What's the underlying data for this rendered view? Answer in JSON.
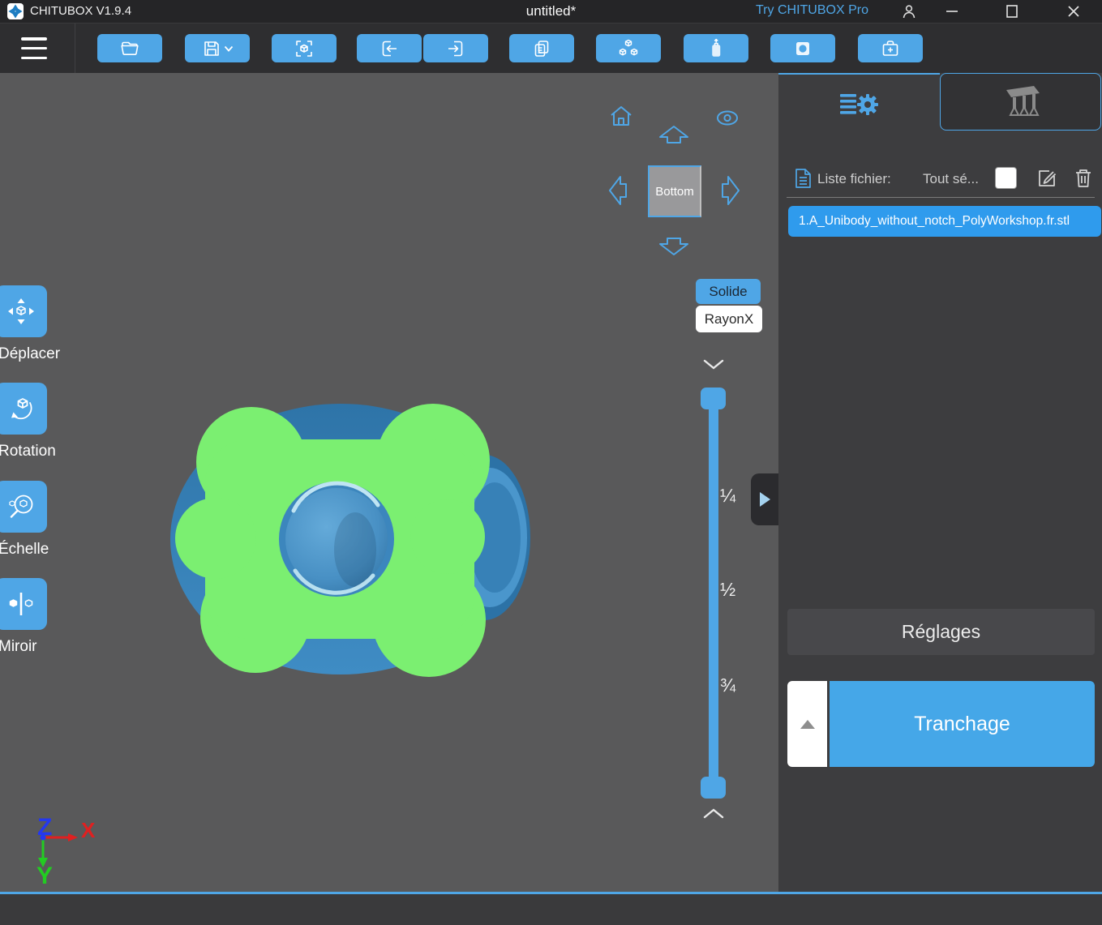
{
  "titlebar": {
    "app_title": "CHITUBOX V1.9.4",
    "document_title": "untitled*",
    "pro_link": "Try CHITUBOX Pro"
  },
  "toolbar": {
    "icons": [
      "open-file",
      "save",
      "capture",
      "import",
      "export",
      "copy",
      "auto-layout",
      "resin",
      "hollow",
      "dig-hole"
    ]
  },
  "left_tools": [
    {
      "id": "move",
      "label": "Déplacer"
    },
    {
      "id": "rotate",
      "label": "Rotation"
    },
    {
      "id": "scale",
      "label": "Échelle"
    },
    {
      "id": "mirror",
      "label": "Miroir"
    }
  ],
  "viewport": {
    "view_cube_face": "Bottom",
    "modes": [
      {
        "label": "Solide",
        "active": true
      },
      {
        "label": "RayonX",
        "active": false
      }
    ],
    "slider_marks": [
      "¼",
      "½",
      "¾"
    ],
    "axis": {
      "x": "X",
      "y": "Y",
      "z": "Z"
    }
  },
  "right_panel": {
    "file_list_label": "Liste fichier:",
    "select_all_label": "Tout sé...",
    "select_all_checked": false,
    "files": [
      {
        "name": "1.A_Unibody_without_notch_PolyWorkshop.fr.stl",
        "selected": true
      }
    ],
    "settings_button": "Réglages",
    "slice_button": "Tranchage"
  },
  "colors": {
    "accent": "#4FA6E6",
    "file_item": "#2F9BED",
    "model_green": "#7BEF71",
    "model_blue": "#3C86BD",
    "viewport_bg": "#59595A",
    "panel_bg": "#3D3D3F"
  }
}
